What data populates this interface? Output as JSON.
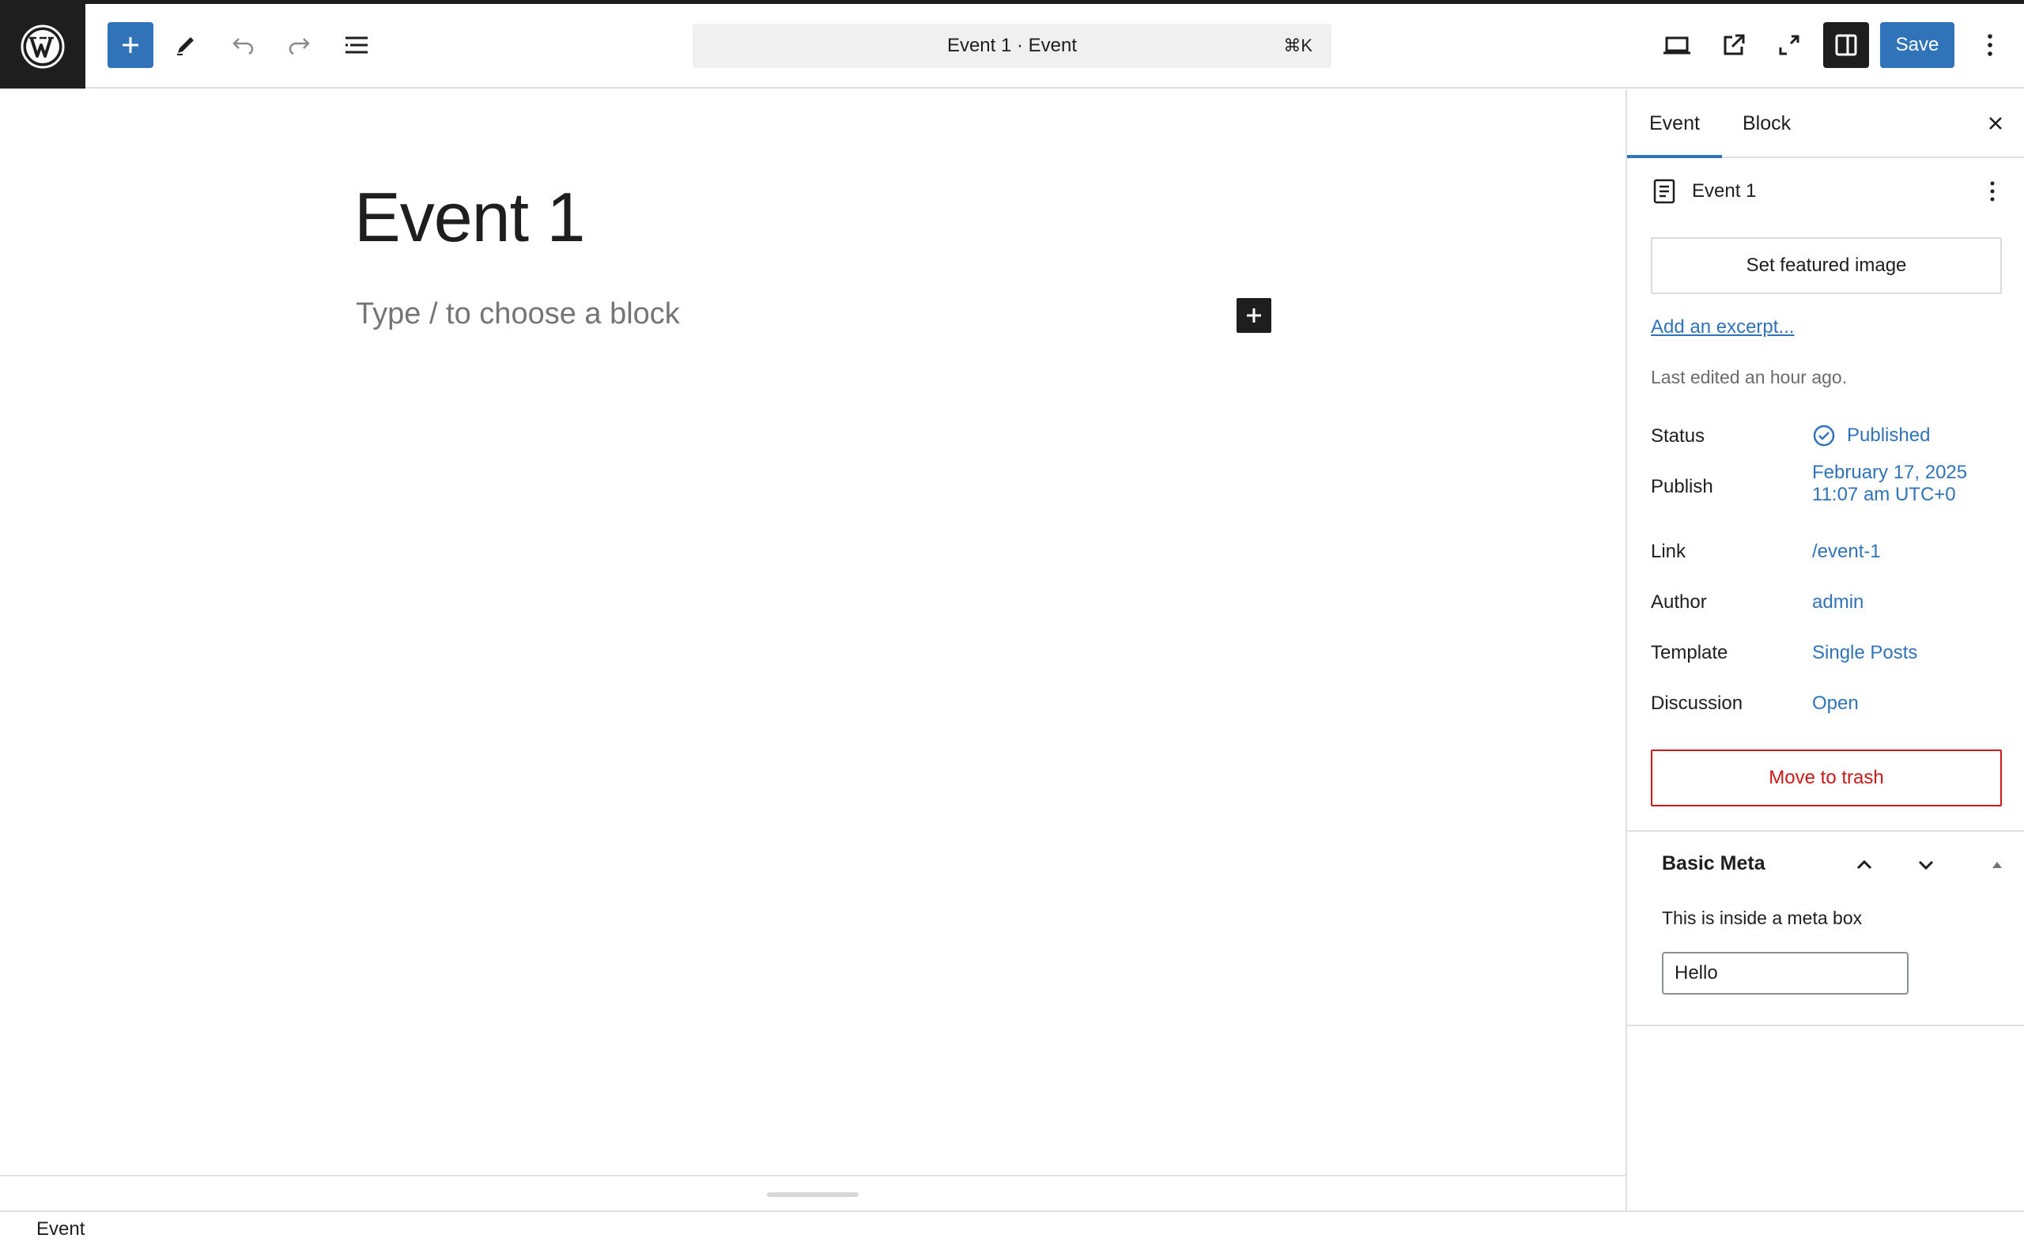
{
  "toolbar": {
    "document_title": "Event 1 · Event",
    "shortcut": "⌘K",
    "save_label": "Save"
  },
  "editor": {
    "post_title": "Event 1",
    "block_placeholder": "Type / to choose a block"
  },
  "footer": {
    "breadcrumb": "Event"
  },
  "sidebar": {
    "tabs": [
      {
        "label": "Event",
        "active": true
      },
      {
        "label": "Block",
        "active": false
      }
    ],
    "post_summary": {
      "title": "Event 1",
      "featured_image_label": "Set featured image",
      "excerpt_link": "Add an excerpt...",
      "last_edited": "Last edited an hour ago."
    },
    "rows": {
      "status": {
        "label": "Status",
        "value": "Published"
      },
      "publish": {
        "label": "Publish",
        "value_line1": "February 17, 2025",
        "value_line2": "11:07 am UTC+0"
      },
      "link": {
        "label": "Link",
        "value": "/event-1"
      },
      "author": {
        "label": "Author",
        "value": "admin"
      },
      "template": {
        "label": "Template",
        "value": "Single Posts"
      },
      "discussion": {
        "label": "Discussion",
        "value": "Open"
      }
    },
    "trash_label": "Move to trash",
    "metabox": {
      "title": "Basic Meta",
      "description": "This is inside a meta box",
      "input_value": "Hello"
    }
  },
  "colors": {
    "accent": "#3173b9",
    "danger": "#cc1818",
    "dark": "#1e1e1e"
  }
}
